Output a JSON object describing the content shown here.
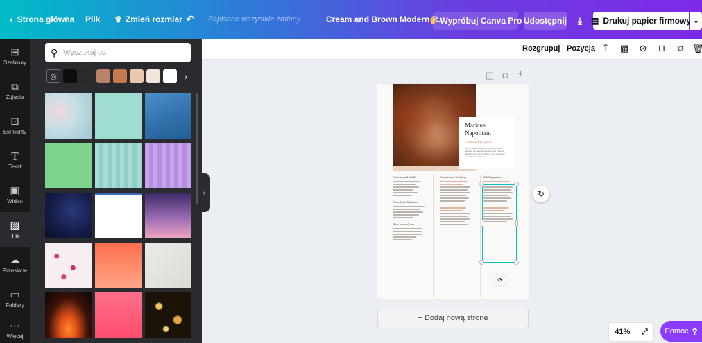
{
  "topbar": {
    "home_label": "Strona główna",
    "file_label": "Plik",
    "resize_label": "Zmień rozmiar",
    "saved_status": "Zapisano wszystkie zmiany",
    "document_title": "Cream and Brown Modern R...",
    "try_pro_label": "Wypróbuj Canva Pro",
    "share_label": "Udostępnij",
    "print_label": "Drukuj papier firmowy"
  },
  "rail": {
    "items": [
      {
        "label": "Szablony",
        "icon": "template-icon"
      },
      {
        "label": "Zdjęcia",
        "icon": "photo-icon"
      },
      {
        "label": "Elementy",
        "icon": "shapes-icon"
      },
      {
        "label": "Tekst",
        "icon": "text-icon"
      },
      {
        "label": "Wideo",
        "icon": "video-icon"
      },
      {
        "label": "Tło",
        "icon": "background-icon"
      },
      {
        "label": "Przesłane",
        "icon": "upload-icon"
      },
      {
        "label": "Foldery",
        "icon": "folder-icon"
      },
      {
        "label": "Więcej",
        "icon": "more-icon"
      }
    ],
    "active": "Tło"
  },
  "panel": {
    "search_placeholder": "Wyszukaj tła",
    "swatch_colors": [
      "#0e0e0f",
      "#2a2a2c",
      "#b98265",
      "#c57b4f",
      "#e9c9ae",
      "#f3e5d8",
      "#ffffff"
    ]
  },
  "toolbar": {
    "ungroup_label": "Rozgrupuj",
    "position_label": "Pozycja"
  },
  "resume": {
    "name": "Mariana Napolitani",
    "role": "Fashion Designer",
    "bio": "I am a fashion designer with experience handling all aspects of design and product development. I am looking a new role which leverages me skill set",
    "col1_headings": [
      "Professional Skills",
      "Awards & Citations",
      "How to reach me"
    ],
    "col2_headings": [
      "Educational Training"
    ],
    "col3_headings": [
      "Job Experience"
    ]
  },
  "canvas": {
    "add_page_label": "+ Dodaj nową stronę"
  },
  "footer": {
    "zoom": "41%",
    "help_label": "Pomoc",
    "help_mark": "?"
  }
}
